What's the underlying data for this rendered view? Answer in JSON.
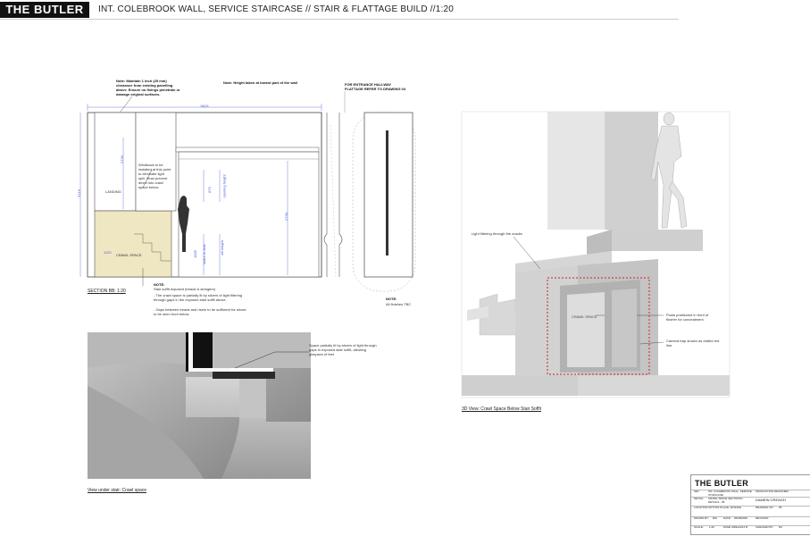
{
  "header": {
    "logo": "THE BUTLER",
    "title": "INT. COLEBROOK WALL, SERVICE STAIRCASE // STAIR & FLATTAGE BUILD //1:20"
  },
  "section": {
    "note_top_left": "Note: Maintain 1 inch (25 mm) clearance from existing panelling above. Ensure no fixings penetrate or damage original surfaces.",
    "note_top_mid": "Note: Height taken at lowest part of the wall",
    "note_top_right": "FOR ENTRANCE HALLWAY FLATTAGE REFER TO DRAWING 04",
    "dim_width": "5815",
    "dim_height_left": "3716",
    "dim_landing_h": "2730",
    "dim_mid": "2730",
    "dim_crawl": "1120",
    "dim_opening": "870",
    "dim_1585": "1585",
    "label_opening_height": "opening height",
    "label_sill_height": "sill height",
    "label_stairs_to_stair": "stairs to stair",
    "landing": "LANDING",
    "crawl_space": "CRAWL SPACE",
    "windback_note": "Windback to be installed at this point to eliminate light spill. Must prevent direct into crawl space below.",
    "caption": "SECTION BB: 1:20",
    "note_bottom_title": "NOTE:",
    "note_bottom_1": "Stair soffit exposed (treads & stringers)",
    "note_bottom_2": "- The crawl space is partially lit by slivers of light filtering through gaps in the exposed stair soffit above.",
    "note_bottom_3": "- Gaps between treads and risers to be sufficient for shoes to be seen from below.",
    "note_finishes_title": "NOTE:",
    "note_finishes": "All finishes TBC"
  },
  "render_under": {
    "callout": "Space partially lit by slivers of light through gaps in exposed stair soffit, allowing glimpses of feet",
    "caption": "View under stair: Crawl space"
  },
  "render_3d": {
    "callout_light": "Light filtering through the cracks",
    "crawl_space": "CRAWL SPACE",
    "callout_posts": "Posts positioned in front of flusher for concealment.",
    "callout_camera": "Camera trap shown as dotted red line.",
    "caption": "3D View: Crawl Space Below Stair Soffit"
  },
  "title_block": {
    "brand": "THE BUTLER",
    "set_label": "SET:",
    "set_value": "INT. COLEBROOK WALL, SERVICE STAIRCASE",
    "detail_label": "DETAIL:",
    "detail_value": "CRAWL SPACE SECTIONS / DETAILS - 05",
    "location_label": "LOCATION:",
    "location_value": "SUTTON PLACE, WOKING",
    "drawn_label": "DRAWN BY:",
    "drawn_value": "RM",
    "date_label": "DATE:",
    "date_value": "05/08/2020",
    "scale_label": "SCALE:",
    "scale_value": "1:20",
    "page_label": "PAGE SIZE:",
    "page_value": "A3/A1 B",
    "pd_label": "PRODUCTION DESIGNER:",
    "pd_value": "DAMEIN CREAGH",
    "drawing_no_label": "DRAWING NO:",
    "drawing_no_value": "05",
    "revision_label": "REVISION:",
    "checked_label": "CHECKED BY:",
    "checked_value": "DC"
  },
  "colors": {
    "crawl_fill": "#efe6c2",
    "dim_blue": "#4a5fd0",
    "camera_trap_red": "#d02020"
  }
}
